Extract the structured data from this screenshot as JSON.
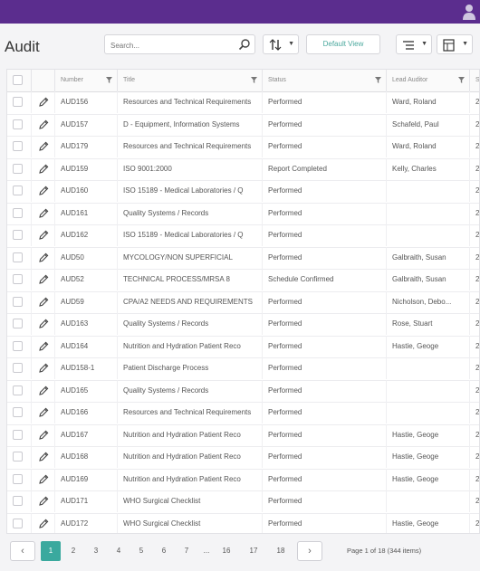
{
  "page": {
    "title": "Audit"
  },
  "search": {
    "placeholder": "Search..."
  },
  "toolbar": {
    "default_view_label": "Default View"
  },
  "colors": {
    "topbar": "#5b2d8e",
    "accent": "#3aa99e"
  },
  "grid": {
    "columns": [
      "Number",
      "Title",
      "Status",
      "Lead Auditor",
      "Sc"
    ],
    "rows": [
      [
        "AUD156",
        "Resources and Technical Requirements",
        "Performed",
        "Ward, Roland",
        "2"
      ],
      [
        "AUD157",
        "D - Equipment, Information Systems",
        "Performed",
        "Schafeld, Paul",
        "2"
      ],
      [
        "AUD179",
        "Resources and Technical Requirements",
        "Performed",
        "Ward, Roland",
        "2"
      ],
      [
        "AUD159",
        "ISO 9001:2000",
        "Report Completed",
        "Kelly, Charles",
        "2"
      ],
      [
        "AUD160",
        "ISO 15189 - Medical Laboratories / Q",
        "Performed",
        "",
        "2"
      ],
      [
        "AUD161",
        "Quality Systems / Records",
        "Performed",
        "",
        "2"
      ],
      [
        "AUD162",
        "ISO 15189 - Medical Laboratories / Q",
        "Performed",
        "",
        "2"
      ],
      [
        "AUD50",
        "MYCOLOGY/NON SUPERFICIAL",
        "Performed",
        "Galbraith, Susan",
        "2"
      ],
      [
        "AUD52",
        "TECHNICAL PROCESS/MRSA 8",
        "Schedule Confirmed",
        "Galbraith, Susan",
        "2"
      ],
      [
        "AUD59",
        "CPA/A2 NEEDS AND REQUIREMENTS",
        "Performed",
        "Nicholson, Debo...",
        "2"
      ],
      [
        "AUD163",
        "Quality Systems / Records",
        "Performed",
        "Rose, Stuart",
        "2"
      ],
      [
        "AUD164",
        "Nutrition and Hydration Patient Reco",
        "Performed",
        "Hastie, Geoge",
        "2"
      ],
      [
        "AUD158-1",
        "Patient Discharge Process",
        "Performed",
        "",
        "2"
      ],
      [
        "AUD165",
        "Quality Systems / Records",
        "Performed",
        "",
        "2"
      ],
      [
        "AUD166",
        "Resources and Technical Requirements",
        "Performed",
        "",
        "2"
      ],
      [
        "AUD167",
        "Nutrition and Hydration Patient Reco",
        "Performed",
        "Hastie, Geoge",
        "2"
      ],
      [
        "AUD168",
        "Nutrition and Hydration Patient Reco",
        "Performed",
        "Hastie, Geoge",
        "2"
      ],
      [
        "AUD169",
        "Nutrition and Hydration Patient Reco",
        "Performed",
        "Hastie, Geoge",
        "2"
      ],
      [
        "AUD171",
        "WHO Surgical Checklist",
        "Performed",
        "",
        "2"
      ],
      [
        "AUD172",
        "WHO Surgical Checklist",
        "Performed",
        "Hastie, Geoge",
        "2"
      ]
    ]
  },
  "pagination": {
    "pages": [
      "1",
      "2",
      "3",
      "4",
      "5",
      "6",
      "7",
      "...",
      "16",
      "17",
      "18"
    ],
    "current": "1",
    "info": "Page 1 of 18 (344 items)",
    "prev_icon": "‹",
    "next_icon": "›"
  }
}
